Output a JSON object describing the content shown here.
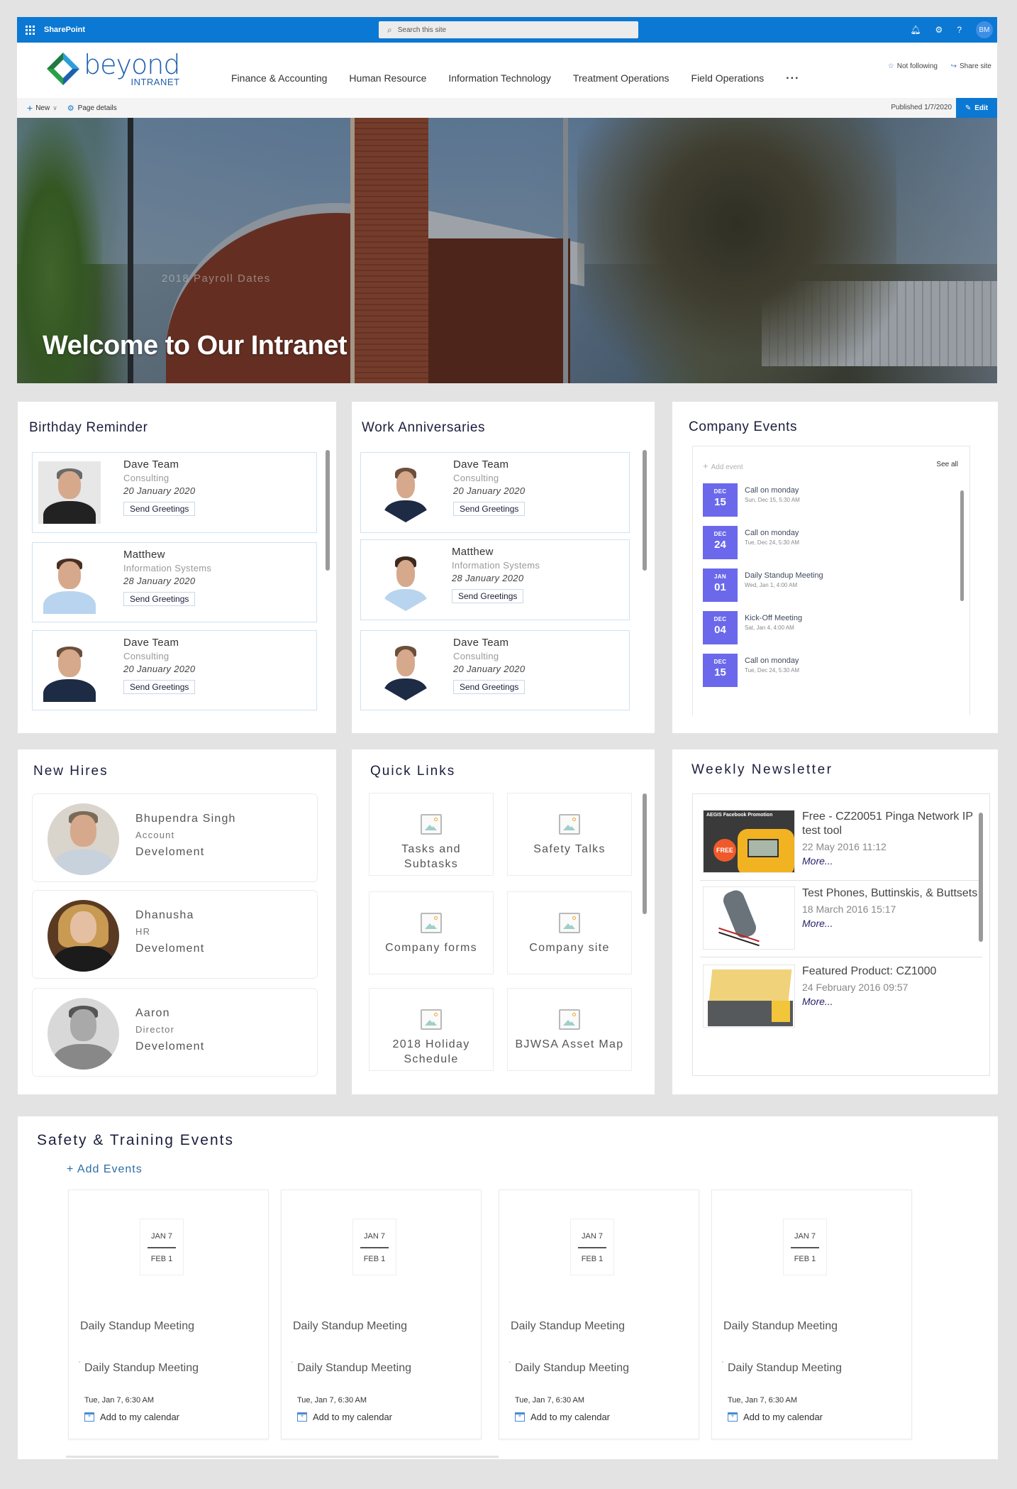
{
  "suitebar": {
    "app_name": "SharePoint",
    "search_placeholder": "Search this site",
    "user_initials": "BM"
  },
  "site": {
    "logo_main": "beyond",
    "logo_sub": "INTRANET",
    "nav": [
      "Finance & Accounting",
      "Human Resource",
      "Information Technology",
      "Treatment Operations",
      "Field Operations"
    ],
    "nav_more": "...",
    "follow_label": "Not following",
    "share_label": "Share site"
  },
  "commandbar": {
    "new_label": "New",
    "page_details_label": "Page details",
    "published": "Published 1/7/2020",
    "edit_label": "Edit"
  },
  "hero": {
    "ghost_text": "2018 Payroll Dates",
    "title": "Welcome to Our Intranet"
  },
  "birthday": {
    "title": "Birthday Reminder",
    "items": [
      {
        "name": "Dave Team",
        "dept": "Consulting",
        "date": "20 January 2020",
        "button": "Send Greetings"
      },
      {
        "name": "Matthew",
        "dept": "Information Systems",
        "date": "28 January 2020",
        "button": "Send Greetings"
      },
      {
        "name": "Dave Team",
        "dept": "Consulting",
        "date": "20 January 2020",
        "button": "Send Greetings"
      }
    ]
  },
  "anniversaries": {
    "title": "Work Anniversaries",
    "items": [
      {
        "name": "Dave Team",
        "dept": "Consulting",
        "date": "20 January 2020",
        "button": "Send Greetings"
      },
      {
        "name": "Matthew",
        "dept": "Information Systems",
        "date": "28 January 2020",
        "button": "Send Greetings"
      },
      {
        "name": "Dave Team",
        "dept": "Consulting",
        "date": "20 January 2020",
        "button": "Send Greetings"
      }
    ]
  },
  "company_events": {
    "title": "Company Events",
    "add_label": "Add event",
    "see_all": "See all",
    "accent": "#6b68ec",
    "items": [
      {
        "month": "DEC",
        "day": "15",
        "title": "Call on monday",
        "when": "Sun, Dec 15, 5:30 AM"
      },
      {
        "month": "DEC",
        "day": "24",
        "title": "Call on monday",
        "when": "Tue, Dec 24, 5:30 AM"
      },
      {
        "month": "JAN",
        "day": "01",
        "title": "Daily Standup Meeting",
        "when": "Wed, Jan 1, 4:00 AM"
      },
      {
        "month": "DEC",
        "day": "04",
        "title": "Kick-Off Meeting",
        "when": "Sat, Jan 4, 4:00 AM"
      },
      {
        "month": "DEC",
        "day": "15",
        "title": "Call on monday",
        "when": "Tue, Dec 24, 5:30 AM"
      }
    ]
  },
  "new_hires": {
    "title": "New Hires",
    "items": [
      {
        "name": "Bhupendra Singh",
        "role": "Account",
        "dept": "Develoment"
      },
      {
        "name": "Dhanusha",
        "role": "HR",
        "dept": "Develoment"
      },
      {
        "name": "Aaron",
        "role": "Director",
        "dept": "Develoment"
      }
    ]
  },
  "quick_links": {
    "title": "Quick Links",
    "items": [
      "Tasks and Subtasks",
      "Safety Talks",
      "Company forms",
      "Company site",
      "2018 Holiday Schedule",
      "BJWSA Asset Map"
    ]
  },
  "newsletter": {
    "title": "Weekly Newsletter",
    "items": [
      {
        "title": "Free - CZ20051 Pinga Network IP test tool",
        "date": "22 May 2016 11:12",
        "more": "More...",
        "thumb_caption": "AEGIS Facebook Promotion",
        "thumb_badge": "FREE"
      },
      {
        "title": "Test Phones, Buttinskis, & Buttsets",
        "date": "18 March 2016 15:17",
        "more": "More..."
      },
      {
        "title": "Featured Product: CZ1000",
        "date": "24 February 2016 09:57",
        "more": "More..."
      }
    ]
  },
  "safety": {
    "title": "Safety & Training Events",
    "add_label": "+ Add Events",
    "cards": [
      {
        "start": "JAN 7",
        "end": "FEB 1",
        "title": "Daily Standup Meeting",
        "subtitle": "Daily Standup Meeting",
        "time": "Tue, Jan 7, 6:30 AM",
        "calendar": "Add to my calendar"
      },
      {
        "start": "JAN 7",
        "end": "FEB 1",
        "title": "Daily Standup Meeting",
        "subtitle": "Daily Standup Meeting",
        "time": "Tue, Jan 7, 6:30 AM",
        "calendar": "Add to my calendar"
      },
      {
        "start": "JAN 7",
        "end": "FEB 1",
        "title": "Daily Standup Meeting",
        "subtitle": "Daily Standup Meeting",
        "time": "Tue, Jan 7, 6:30 AM",
        "calendar": "Add to my calendar"
      },
      {
        "start": "JAN 7",
        "end": "FEB 1",
        "title": "Daily Standup Meeting",
        "subtitle": "Daily Standup Meeting",
        "time": "Tue, Jan 7, 6:30 AM",
        "calendar": "Add to my calendar"
      }
    ]
  }
}
